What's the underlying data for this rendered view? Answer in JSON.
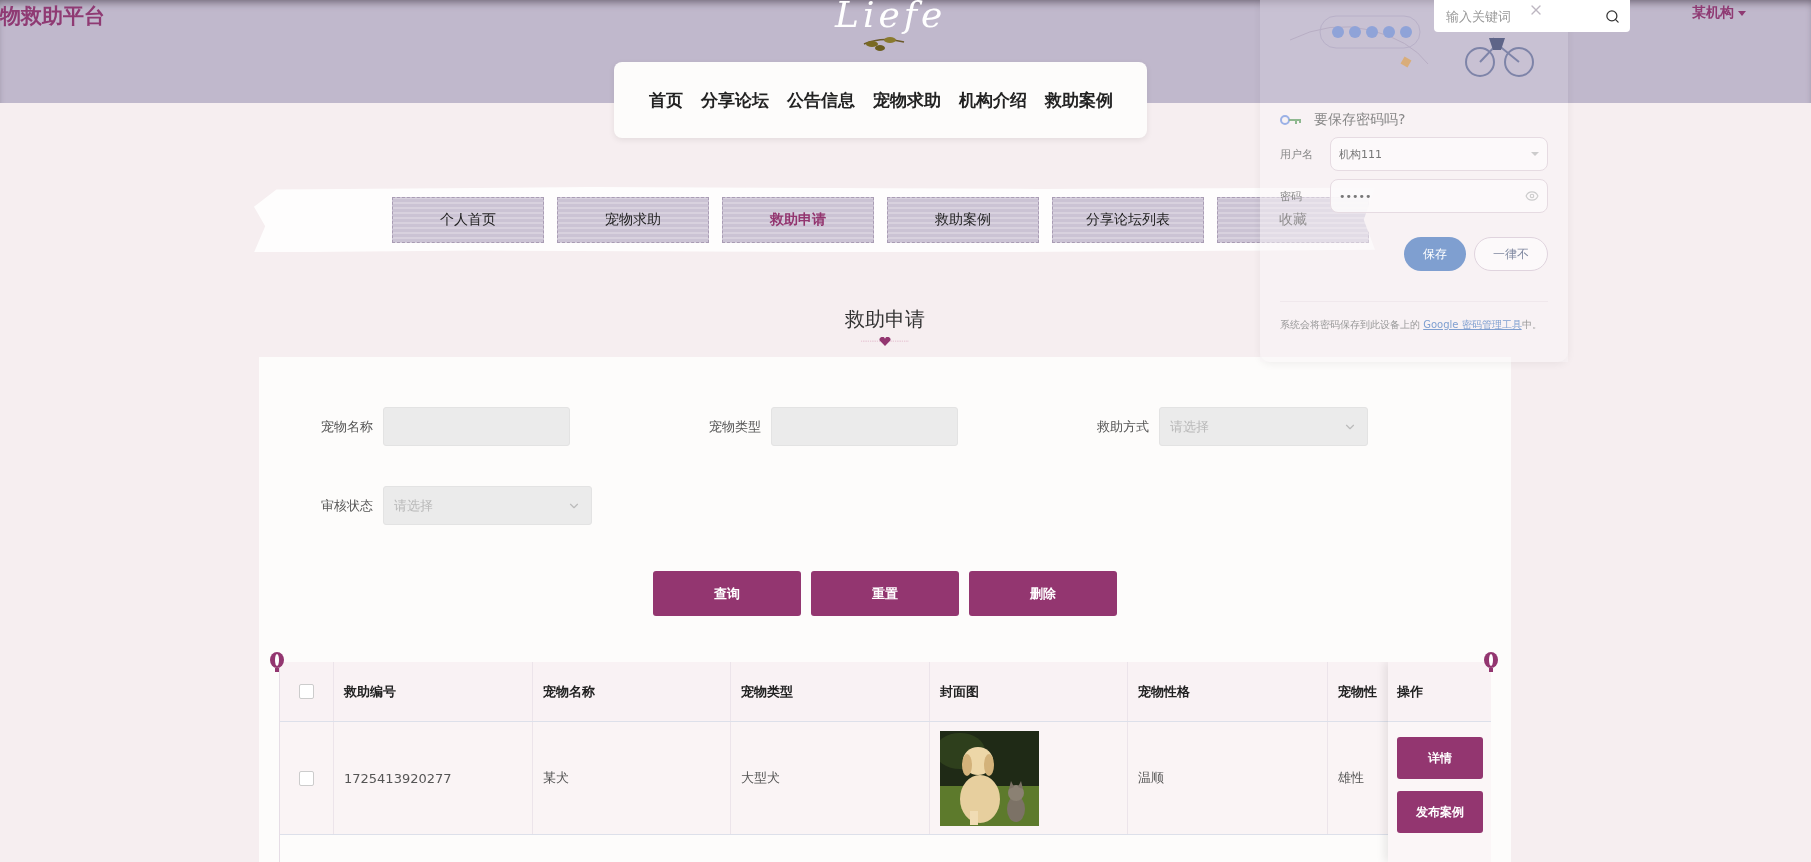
{
  "header": {
    "site_title": "物救助平台",
    "logo": "Liefe",
    "search": {
      "placeholder": "输入关键词"
    },
    "user_menu": "某机构"
  },
  "nav": [
    "首页",
    "分享论坛",
    "公告信息",
    "宠物求助",
    "机构介绍",
    "救助案例"
  ],
  "tabs": [
    {
      "label": "个人首页",
      "selected": false
    },
    {
      "label": "宠物求助",
      "selected": false
    },
    {
      "label": "救助申请",
      "selected": true
    },
    {
      "label": "救助案例",
      "selected": false
    },
    {
      "label": "分享论坛列表",
      "selected": false
    },
    {
      "label": "收藏",
      "selected": false
    }
  ],
  "section_title": "救助申请",
  "filters": [
    {
      "label": "宠物名称",
      "kind": "text"
    },
    {
      "label": "宠物类型",
      "kind": "text"
    },
    {
      "label": "救助方式",
      "kind": "select",
      "placeholder": "请选择"
    },
    {
      "label": "审核状态",
      "kind": "select",
      "placeholder": "请选择"
    }
  ],
  "actions": [
    "查询",
    "重置",
    "删除"
  ],
  "table": {
    "select_all_checked": false,
    "columns": [
      "救助编号",
      "宠物名称",
      "宠物类型",
      "封面图",
      "宠物性格",
      "宠物性"
    ],
    "action_column": "操作",
    "rows": [
      {
        "checked": false,
        "id": "1725413920277",
        "name": "某犬",
        "type": "大型犬",
        "cover": {
          "kind": "picture"
        },
        "temperament": "温顺",
        "gender": "雄性",
        "actions": [
          "详情",
          "发布案例"
        ]
      }
    ]
  },
  "password_prompt": {
    "title": "要保存密码吗?",
    "username_label": "用户名",
    "username": "机构111",
    "password_label": "密码",
    "password": "•••••",
    "buttons": [
      {
        "label": "保存",
        "kind": "primary"
      },
      {
        "label": "一律不",
        "kind": "secondary"
      }
    ],
    "note": "系统会将密码保存到此设备上的",
    "note_link": "Google 密码管理工具",
    "note_end": "中。"
  }
}
